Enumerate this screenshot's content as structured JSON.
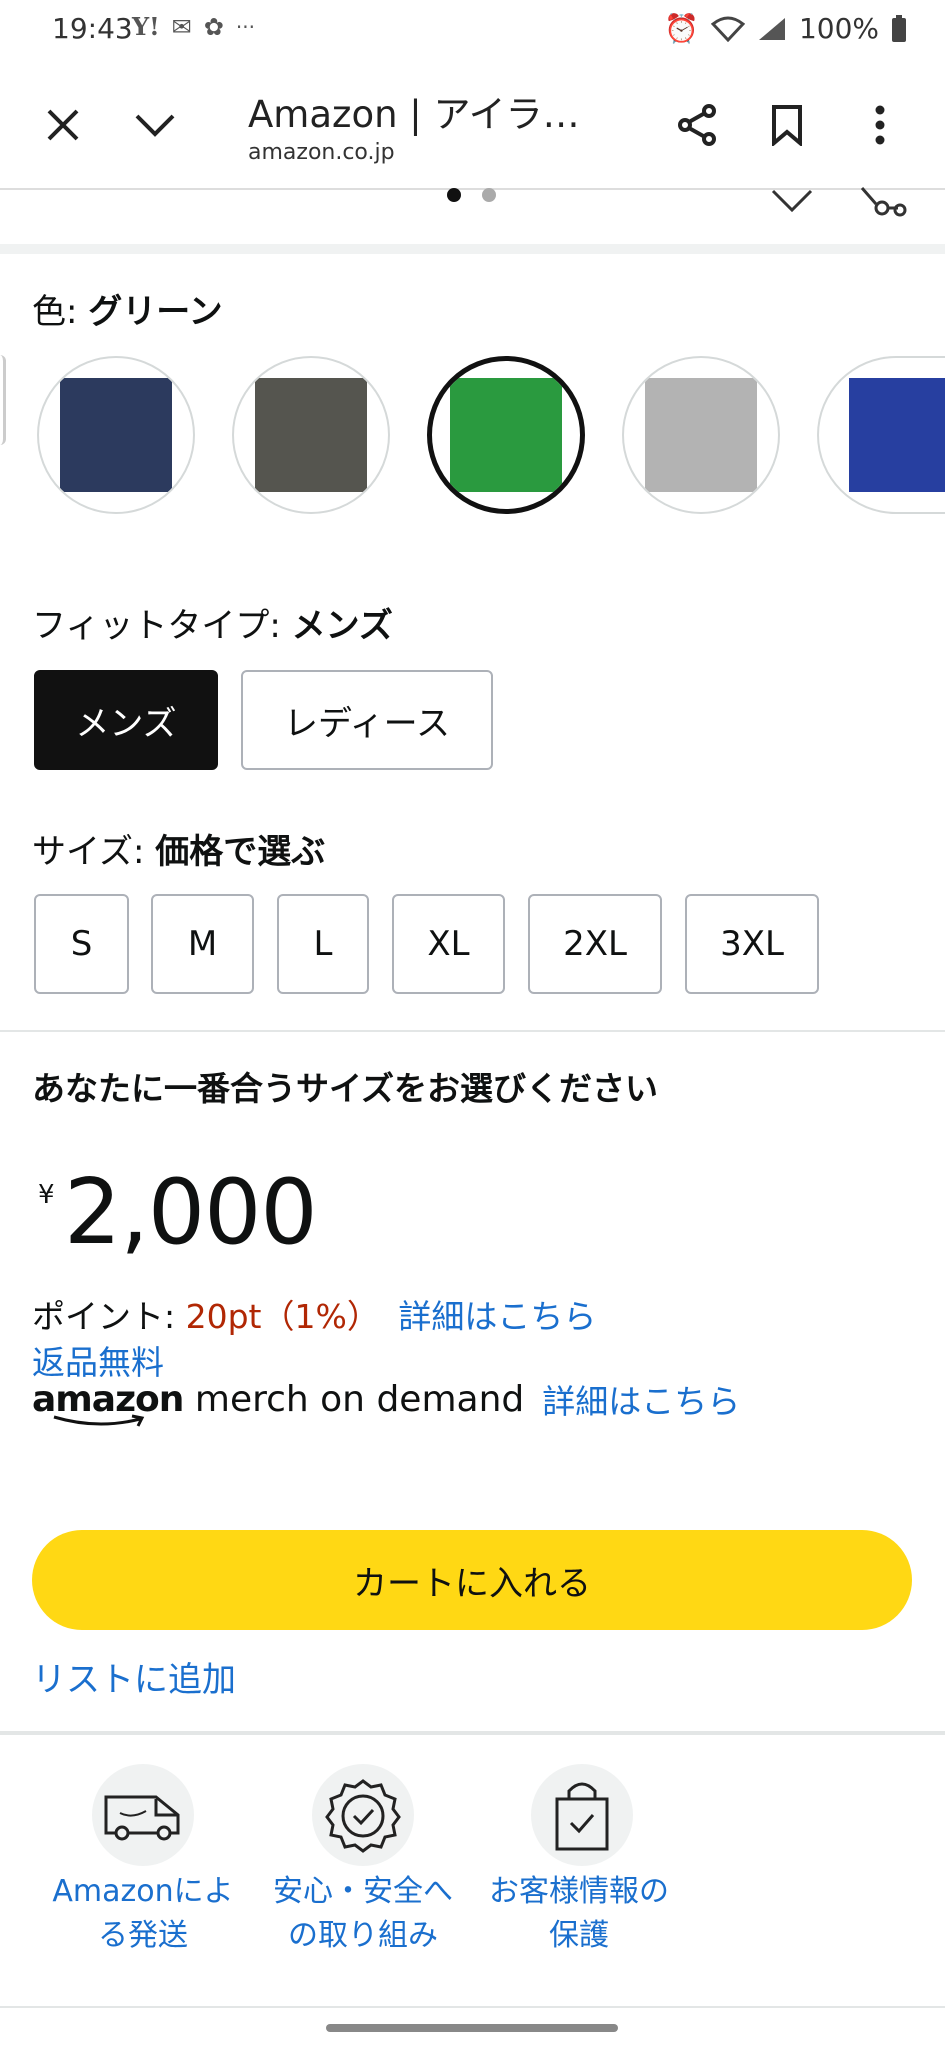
{
  "status_bar": {
    "time": "19:43",
    "icons_left": [
      "yahoo-icon",
      "mail-icon",
      "settings-gear-icon",
      "more-dots-icon"
    ],
    "battery": "100%"
  },
  "browser": {
    "title": "Amazon | アイラ…",
    "url": "amazon.co.jp"
  },
  "color": {
    "label": "色: ",
    "selected": "グリーン",
    "swatches": [
      {
        "name": "navy",
        "color": "#2c3a5e"
      },
      {
        "name": "charcoal",
        "color": "#55554f"
      },
      {
        "name": "green",
        "color": "#2a9a3f",
        "selected": true
      },
      {
        "name": "heather-gray",
        "color": "#b3b3b3"
      },
      {
        "name": "royal-blue",
        "color": "#273fa0"
      }
    ]
  },
  "fit": {
    "label": "フィットタイプ: ",
    "selected": "メンズ",
    "options": [
      "メンズ",
      "レディース"
    ]
  },
  "size": {
    "label": "サイズ: ",
    "selected": "価格で選ぶ",
    "options": [
      "S",
      "M",
      "L",
      "XL",
      "2XL",
      "3XL"
    ]
  },
  "buybox": {
    "heading": "あなたに一番合うサイズをお選びください",
    "currency": "¥",
    "price": "2,000",
    "points_label": "ポイント: ",
    "points_value": "20pt（1%）",
    "details_link": "詳細はこちら",
    "free_returns": "返品無料",
    "merch_logo_amazon": "amazon",
    "merch_logo_rest": "merch on demand",
    "merch_details_link": "詳細はこちら",
    "add_to_cart": "カートに入れる",
    "add_to_list": "リストに追加"
  },
  "trust": [
    {
      "icon": "delivery-van-icon",
      "line1": "Amazonによ",
      "line2": "る発送"
    },
    {
      "icon": "safety-badge-icon",
      "line1": "安心・安全へ",
      "line2": "の取り組み"
    },
    {
      "icon": "secure-bag-icon",
      "line1": "お客様情報の",
      "line2": "保護"
    }
  ],
  "colors": {
    "accent_yellow": "#ffd814",
    "link_blue": "#1a6fce",
    "price_red": "#b12704"
  }
}
